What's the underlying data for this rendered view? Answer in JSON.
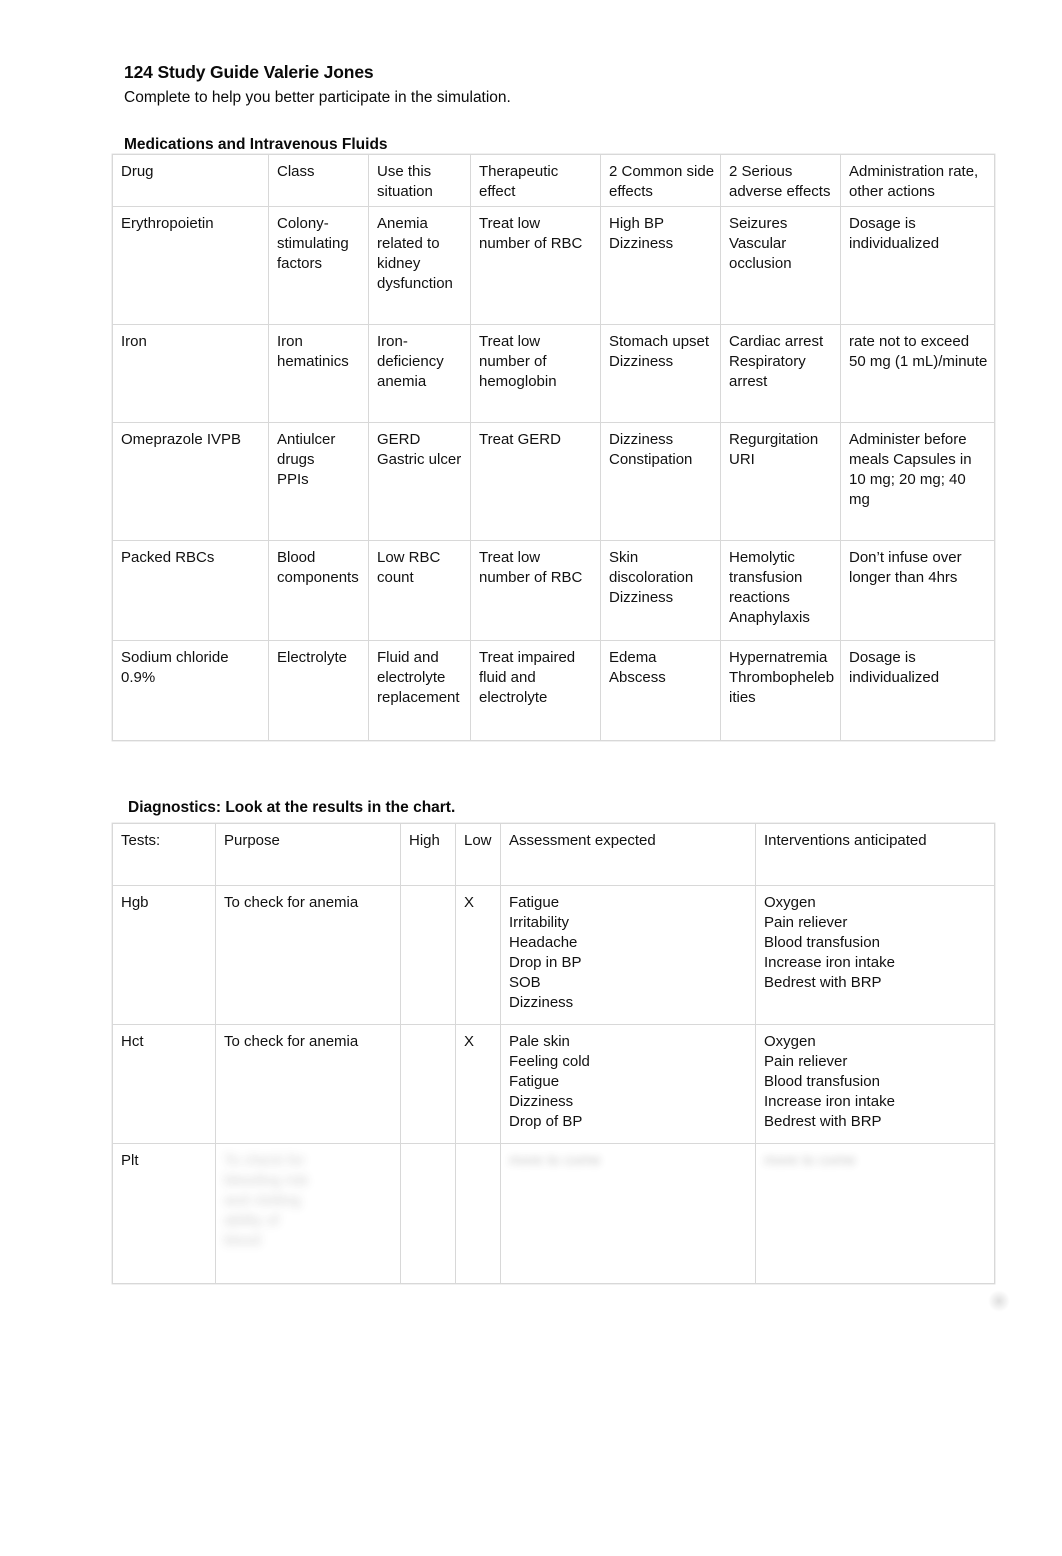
{
  "document": {
    "title": "124 Study Guide Valerie Jones",
    "subtitle": "Complete to help you better participate in the simulation."
  },
  "medications_section": {
    "heading": "Medications and Intravenous Fluids",
    "columns": [
      "Drug",
      "Class",
      "Use this situation",
      "Therapeutic effect",
      "2 Common side effects",
      "2 Serious adverse effects",
      "Administration rate, other actions"
    ],
    "rows": [
      {
        "drug": "Erythropoietin",
        "class": "Colony-stimulating factors",
        "use": "Anemia related to kidney dysfunction",
        "effect": "Treat low number of RBC",
        "common_side_effects": "High BP\nDizziness",
        "serious_adverse_effects": "Seizures\nVascular occlusion",
        "administration": "Dosage is individualized"
      },
      {
        "drug": "Iron",
        "class": "Iron hematinics",
        "use": "Iron-deficiency anemia",
        "effect": "Treat low number of hemoglobin",
        "common_side_effects": "Stomach upset\nDizziness",
        "serious_adverse_effects": "Cardiac arrest\nRespiratory arrest",
        "administration": "rate not to exceed 50 mg (1 mL)/minute"
      },
      {
        "drug": "Omeprazole IVPB",
        "class": "Antiulcer drugs\nPPIs",
        "use": "GERD\nGastric ulcer",
        "effect": "Treat GERD",
        "common_side_effects": "Dizziness\nConstipation",
        "serious_adverse_effects": "Regurgitation\nURI",
        "administration": "Administer before meals Capsules in 10 mg; 20 mg; 40 mg"
      },
      {
        "drug": "Packed RBCs",
        "class": "Blood components",
        "use": "Low RBC count",
        "effect": "Treat low number of RBC",
        "common_side_effects": "Skin discoloration\nDizziness",
        "serious_adverse_effects": "Hemolytic transfusion reactions\nAnaphylaxis",
        "administration": "Don’t infuse over longer than 4hrs"
      },
      {
        "drug": "Sodium chloride 0.9%",
        "class": "Electrolyte",
        "use": "Fluid and electrolyte replacement",
        "effect": "Treat impaired fluid and electrolyte",
        "common_side_effects": "Edema\nAbscess",
        "serious_adverse_effects": "Hypernatremia\nThrombophelebities",
        "administration": "Dosage is individualized"
      }
    ]
  },
  "diagnostics_section": {
    "heading": "Diagnostics:  Look at the results in the chart.",
    "columns": [
      "Tests:",
      "Purpose",
      "High",
      "Low",
      "Assessment expected",
      "Interventions anticipated"
    ],
    "rows": [
      {
        "test": "Hgb",
        "purpose": "To check for anemia",
        "high": "",
        "low": "X",
        "assessment": "Fatigue\nIrritability\nHeadache\nDrop in BP\nSOB\nDizziness",
        "interventions": "Oxygen\nPain reliever\nBlood transfusion\nIncrease iron intake\nBedrest with BRP"
      },
      {
        "test": "Hct",
        "purpose": "To check for anemia",
        "high": "",
        "low": "X",
        "assessment": "Pale skin\nFeeling cold\nFatigue\nDizziness\nDrop of BP",
        "interventions": "Oxygen\nPain reliever\nBlood transfusion\nIncrease iron intake\nBedrest with BRP"
      },
      {
        "test": "Plt",
        "purpose": "",
        "high": "",
        "low": "",
        "assessment": "",
        "interventions": "",
        "illegible": true
      }
    ]
  }
}
